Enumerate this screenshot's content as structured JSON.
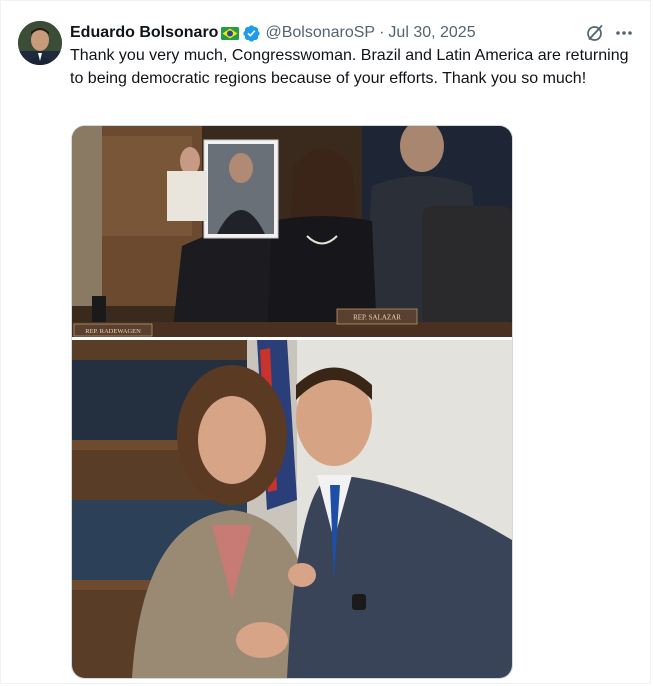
{
  "tweet": {
    "author_name": "Eduardo Bolsonaro",
    "handle": "@BolsonaroSP",
    "separator": "·",
    "date": "Jul 30, 2025",
    "text": "Thank you very much, Congresswoman. Brazil and Latin America are returning to being democratic regions because of your efforts. Thank you so much!"
  },
  "photo1": {
    "nameplate_left": "REP. RADEWAGEN",
    "nameplate_right": "REP. SALAZAR"
  },
  "icons": {
    "verified": "verified-badge-icon",
    "flag": "brazil-flag-icon",
    "grok": "grok-icon",
    "more": "more-options-icon"
  },
  "colors": {
    "verified": "#1d9bf0",
    "secondary_text": "#536471"
  }
}
